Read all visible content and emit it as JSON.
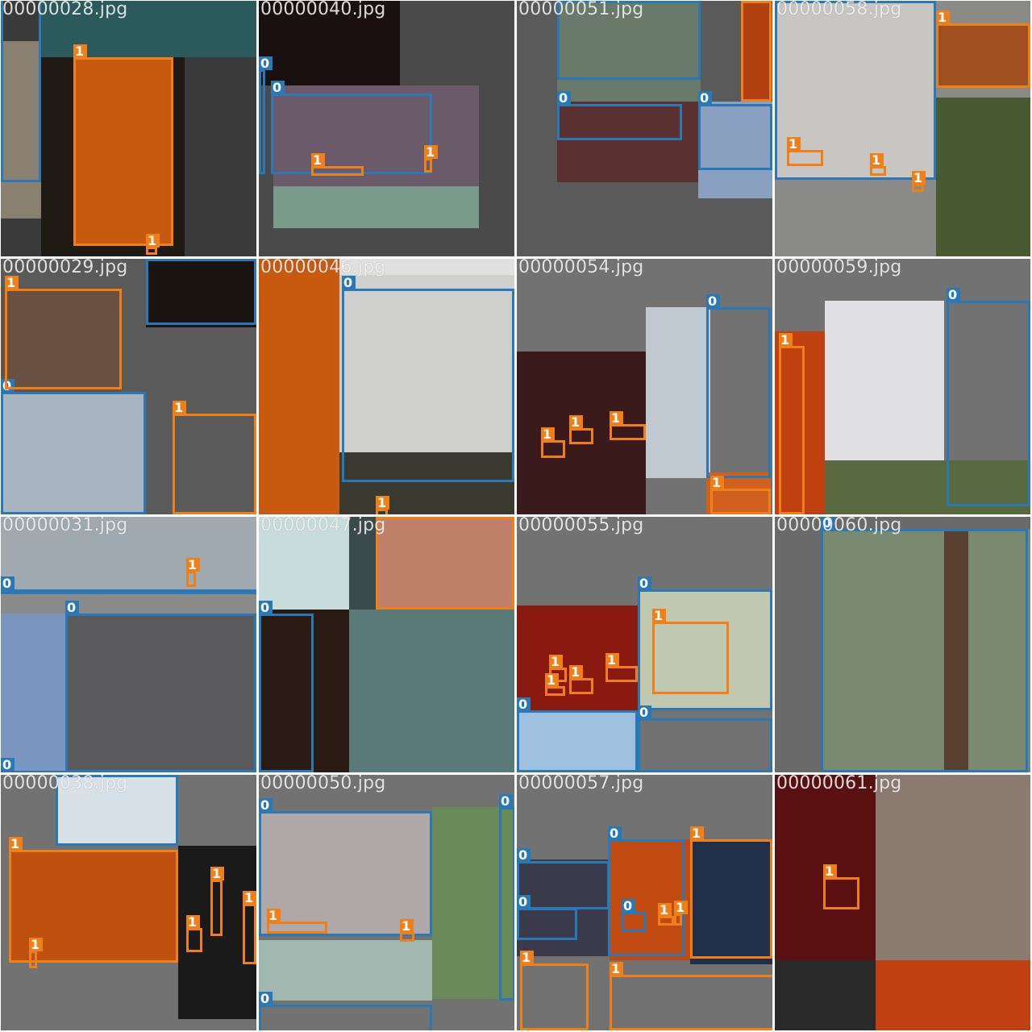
{
  "tiles": [
    {
      "name": "00000028.jpg",
      "bg": "#3a3a3a",
      "patches": [
        "#2a5a5c",
        "#1f1a14",
        "#c85a10",
        "#8a8070"
      ],
      "boxes": [
        [
          "0",
          "0"
        ],
        [
          "1",
          "1"
        ],
        [
          "1",
          "1"
        ]
      ]
    },
    {
      "name": "00000040.jpg",
      "bg": "#4a4a4a",
      "patches": [
        "#1a1010",
        "#6a5a6a",
        "#7a9a8a"
      ],
      "boxes": [
        [
          "0",
          "0"
        ],
        [
          "0",
          "0"
        ],
        [
          "1",
          "1"
        ],
        [
          "1",
          "1"
        ]
      ]
    },
    {
      "name": "00000051.jpg",
      "bg": "#5a5a5a",
      "patches": [
        "#6a7a6a",
        "#5a3030",
        "#b04010",
        "#8aa0c0"
      ],
      "boxes": [
        [
          "0",
          "0"
        ],
        [
          "0",
          "0"
        ],
        [
          "0",
          "0"
        ],
        [
          "1",
          "1"
        ]
      ]
    },
    {
      "name": "00000058.jpg",
      "bg": "#8a8a88",
      "patches": [
        "#c8c6c2",
        "#a05020",
        "#4a5a30"
      ],
      "boxes": [
        [
          "0",
          "0"
        ],
        [
          "1",
          "1"
        ],
        [
          "1",
          "1"
        ],
        [
          "1",
          "1"
        ],
        [
          "1",
          "1"
        ]
      ]
    },
    {
      "name": "00000029.jpg",
      "bg": "#5a5a5a",
      "patches": [
        "#6a5040",
        "#1a1410",
        "#a8b4c0"
      ],
      "boxes": [
        [
          "0",
          "0"
        ],
        [
          "1",
          "1"
        ],
        [
          "1",
          "1"
        ],
        [
          "0",
          "0"
        ]
      ]
    },
    {
      "name": "00000046.jpg",
      "bg": "#e0e0e0",
      "patches": [
        "#c85a10",
        "#cfcfcd",
        "#3a3a30"
      ],
      "boxes": [
        [
          "0",
          "0"
        ],
        [
          "1",
          "1"
        ]
      ]
    },
    {
      "name": "00000054.jpg",
      "bg": "#727272",
      "patches": [
        "#3a1a1a",
        "#c0c8d0",
        "#d06020"
      ],
      "boxes": [
        [
          "0",
          "0"
        ],
        [
          "1",
          "1"
        ],
        [
          "1",
          "1"
        ],
        [
          "1",
          "1"
        ],
        [
          "1",
          "1"
        ],
        [
          "1",
          "1"
        ]
      ]
    },
    {
      "name": "00000059.jpg",
      "bg": "#727272",
      "patches": [
        "#e0e0e4",
        "#c04010",
        "#5a6a40"
      ],
      "boxes": [
        [
          "0",
          "0"
        ],
        [
          "1",
          "1"
        ]
      ]
    },
    {
      "name": "00000031.jpg",
      "bg": "#8a8a8a",
      "patches": [
        "#a0a8b0",
        "#5a5a5c",
        "#7a96c0"
      ],
      "boxes": [
        [
          "1",
          "1"
        ],
        [
          "0",
          "0"
        ],
        [
          "0",
          "0"
        ],
        [
          "0",
          "0"
        ]
      ]
    },
    {
      "name": "00000047.jpg",
      "bg": "#3a4a4a",
      "patches": [
        "#c8dcdc",
        "#c0806a",
        "#5a7a7a",
        "#2a1a14"
      ],
      "boxes": [
        [
          "1",
          "1"
        ],
        [
          "0",
          "0"
        ]
      ]
    },
    {
      "name": "00000055.jpg",
      "bg": "#727272",
      "patches": [
        "#8a1a10",
        "#c0c8b0",
        "#a0c0e0"
      ],
      "boxes": [
        [
          "0",
          "0"
        ],
        [
          "0",
          "0"
        ],
        [
          "0",
          "0"
        ],
        [
          "1",
          "1"
        ],
        [
          "1",
          "1"
        ],
        [
          "1",
          "1"
        ],
        [
          "1",
          "1"
        ],
        [
          "1",
          "1"
        ]
      ]
    },
    {
      "name": "00000060.jpg",
      "bg": "#6a6a6a",
      "patches": [
        "#7a8a70",
        "#5a4030"
      ],
      "boxes": [
        [
          "0",
          "0"
        ]
      ]
    },
    {
      "name": "00000038.jpg",
      "bg": "#727272",
      "patches": [
        "#d8e0e8",
        "#c05010",
        "#1a1a1a"
      ],
      "boxes": [
        [
          "0",
          "0"
        ],
        [
          "1",
          "1"
        ],
        [
          "1",
          "1"
        ],
        [
          "1",
          "1"
        ],
        [
          "1",
          "1"
        ],
        [
          "1",
          "1"
        ]
      ]
    },
    {
      "name": "00000050.jpg",
      "bg": "#727272",
      "patches": [
        "#b0a8a8",
        "#a0b8b0",
        "#6a8a5a"
      ],
      "boxes": [
        [
          "0",
          "0"
        ],
        [
          "0",
          "0"
        ],
        [
          "1",
          "1"
        ],
        [
          "1",
          "1"
        ],
        [
          "0",
          "0"
        ]
      ]
    },
    {
      "name": "00000057.jpg",
      "bg": "#727272",
      "patches": [
        "#3a3a4a",
        "#c04a10",
        "#20304a"
      ],
      "boxes": [
        [
          "0",
          "0"
        ],
        [
          "0",
          "0"
        ],
        [
          "0",
          "0"
        ],
        [
          "1",
          "1"
        ],
        [
          "1",
          "1"
        ],
        [
          "1",
          "1"
        ],
        [
          "0",
          "0"
        ],
        [
          "1",
          "1"
        ],
        [
          "1",
          "1"
        ]
      ]
    },
    {
      "name": "00000061.jpg",
      "bg": "#2a2a2a",
      "patches": [
        "#5a1010",
        "#8a7a70",
        "#c04010"
      ],
      "boxes": [
        [
          "1",
          "1"
        ]
      ]
    }
  ]
}
